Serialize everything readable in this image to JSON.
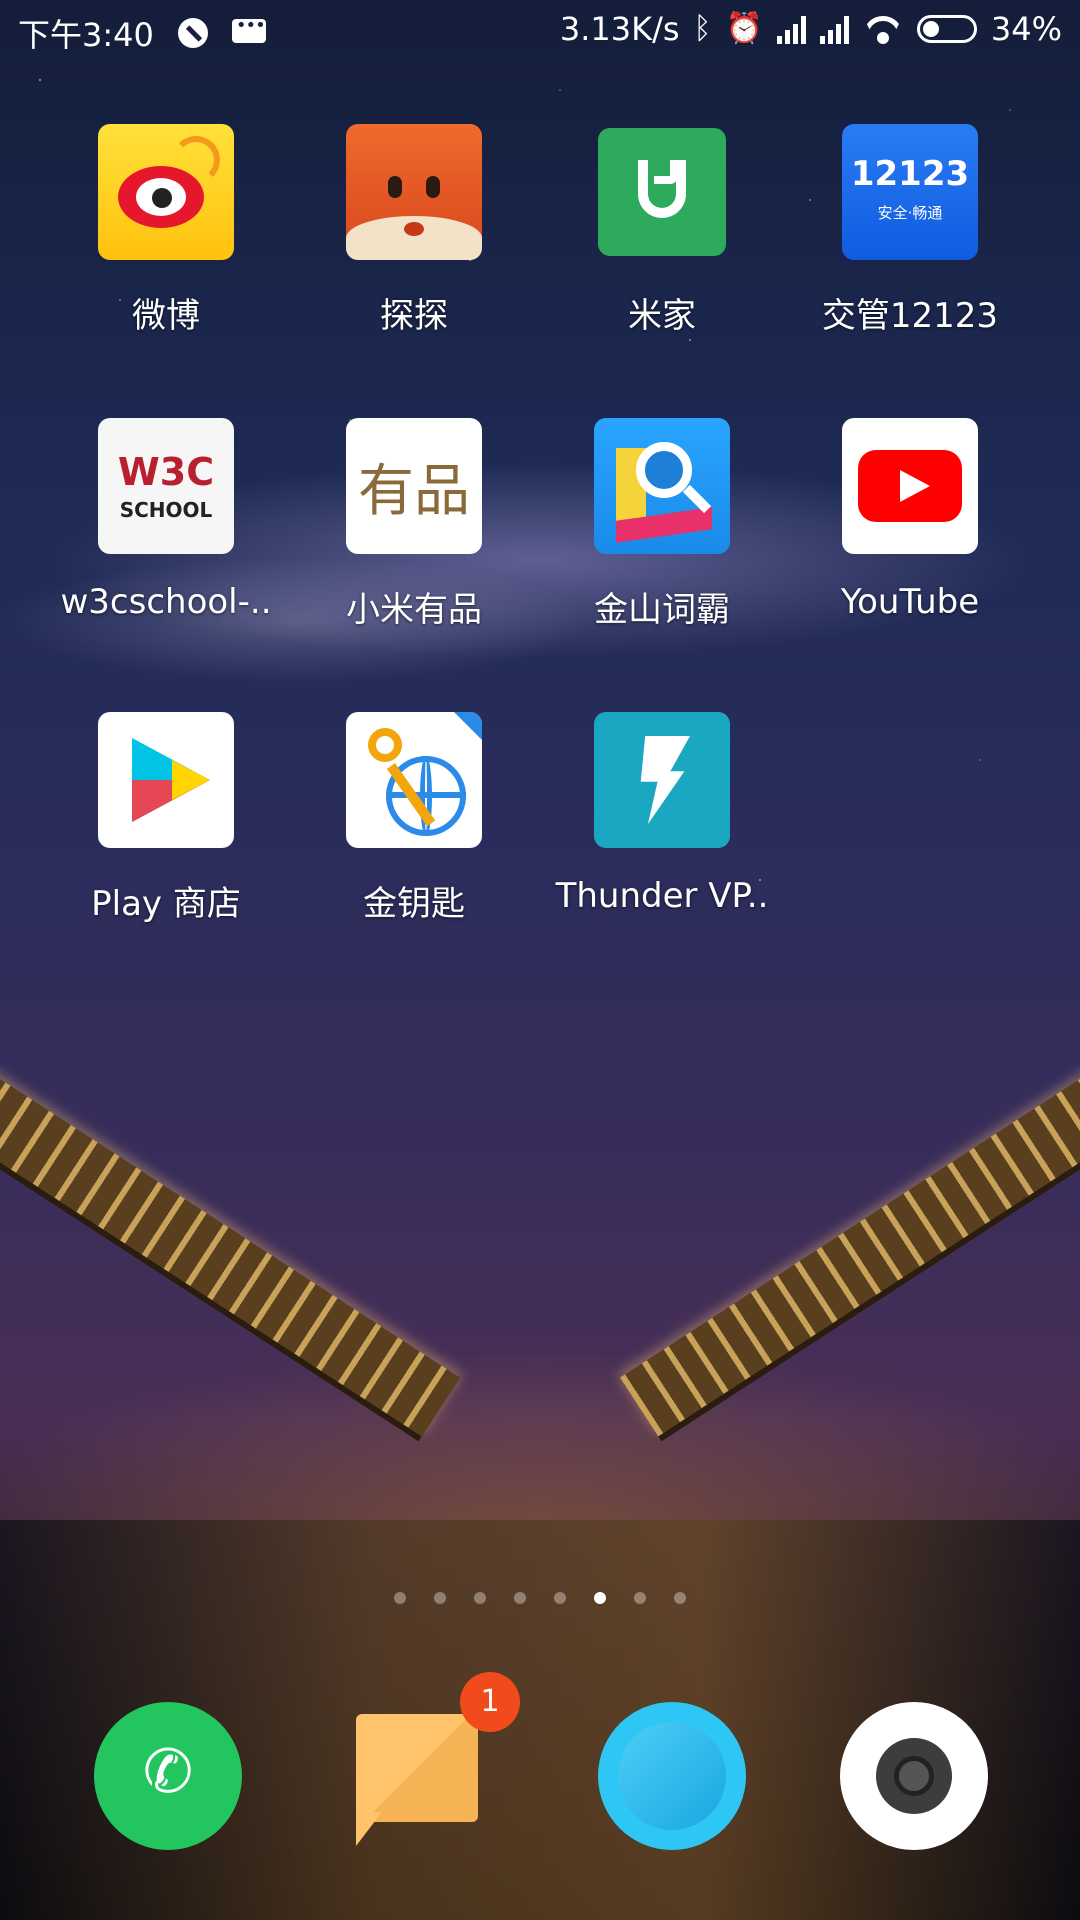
{
  "status_bar": {
    "time": "下午3:40",
    "network_speed": "3.13K/s",
    "battery": "34%",
    "icons": [
      "do-not-disturb-icon",
      "message-icon",
      "bluetooth-icon",
      "alarm-icon",
      "signal-icon",
      "signal-icon",
      "wifi-icon",
      "battery-icon"
    ]
  },
  "apps": [
    {
      "label": "微博",
      "icon": "weibo-icon"
    },
    {
      "label": "探探",
      "icon": "tantan-icon"
    },
    {
      "label": "米家",
      "icon": "mijia-icon"
    },
    {
      "label": "交管12123",
      "icon": "jiaoguan-12123-icon",
      "icon_text": "12123",
      "icon_subtext": "安全·畅通"
    },
    {
      "label": "w3cschool-..",
      "icon": "w3cschool-icon",
      "icon_text": "W3C",
      "icon_subtext": "SCHOOL"
    },
    {
      "label": "小米有品",
      "icon": "xiaomi-youpin-icon",
      "icon_text": "有品"
    },
    {
      "label": "金山词霸",
      "icon": "kingsoft-ciba-icon"
    },
    {
      "label": "YouTube",
      "icon": "youtube-icon"
    },
    {
      "label": "Play 商店",
      "icon": "play-store-icon"
    },
    {
      "label": "金钥匙",
      "icon": "golden-key-icon"
    },
    {
      "label": "Thunder VP..",
      "icon": "thunder-vpn-icon"
    }
  ],
  "page_indicator": {
    "count": 8,
    "active_index": 5
  },
  "dock": [
    {
      "name": "phone",
      "icon": "phone-icon"
    },
    {
      "name": "messages",
      "icon": "messages-icon",
      "badge": "1"
    },
    {
      "name": "browser",
      "icon": "browser-icon"
    },
    {
      "name": "camera",
      "icon": "camera-icon"
    }
  ]
}
